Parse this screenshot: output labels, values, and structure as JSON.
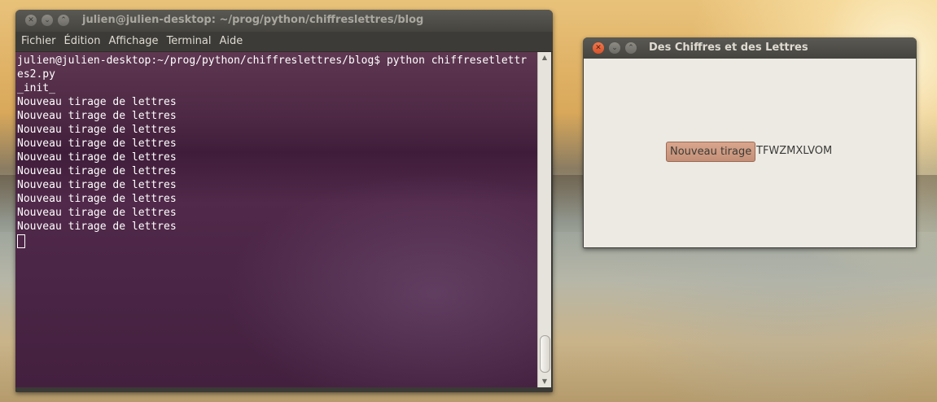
{
  "terminal": {
    "title": "julien@julien-desktop: ~/prog/python/chiffreslettres/blog",
    "menu": [
      "Fichier",
      "Édition",
      "Affichage",
      "Terminal",
      "Aide"
    ],
    "lines": [
      "julien@julien-desktop:~/prog/python/chiffreslettres/blog$ python chiffresetlettr",
      "es2.py",
      "_init_",
      "Nouveau tirage de lettres",
      "Nouveau tirage de lettres",
      "Nouveau tirage de lettres",
      "Nouveau tirage de lettres",
      "Nouveau tirage de lettres",
      "Nouveau tirage de lettres",
      "Nouveau tirage de lettres",
      "Nouveau tirage de lettres",
      "Nouveau tirage de lettres",
      "Nouveau tirage de lettres"
    ]
  },
  "app": {
    "title": "Des Chiffres et des Lettres",
    "button_label": "Nouveau tirage",
    "letters": "TFWZMXLVOM"
  },
  "colors": {
    "terminal_bg": "#4d2844",
    "titlebar": "#45443f",
    "app_body": "#edeae4",
    "button": "#c49178",
    "close_button": "#d7532a"
  }
}
